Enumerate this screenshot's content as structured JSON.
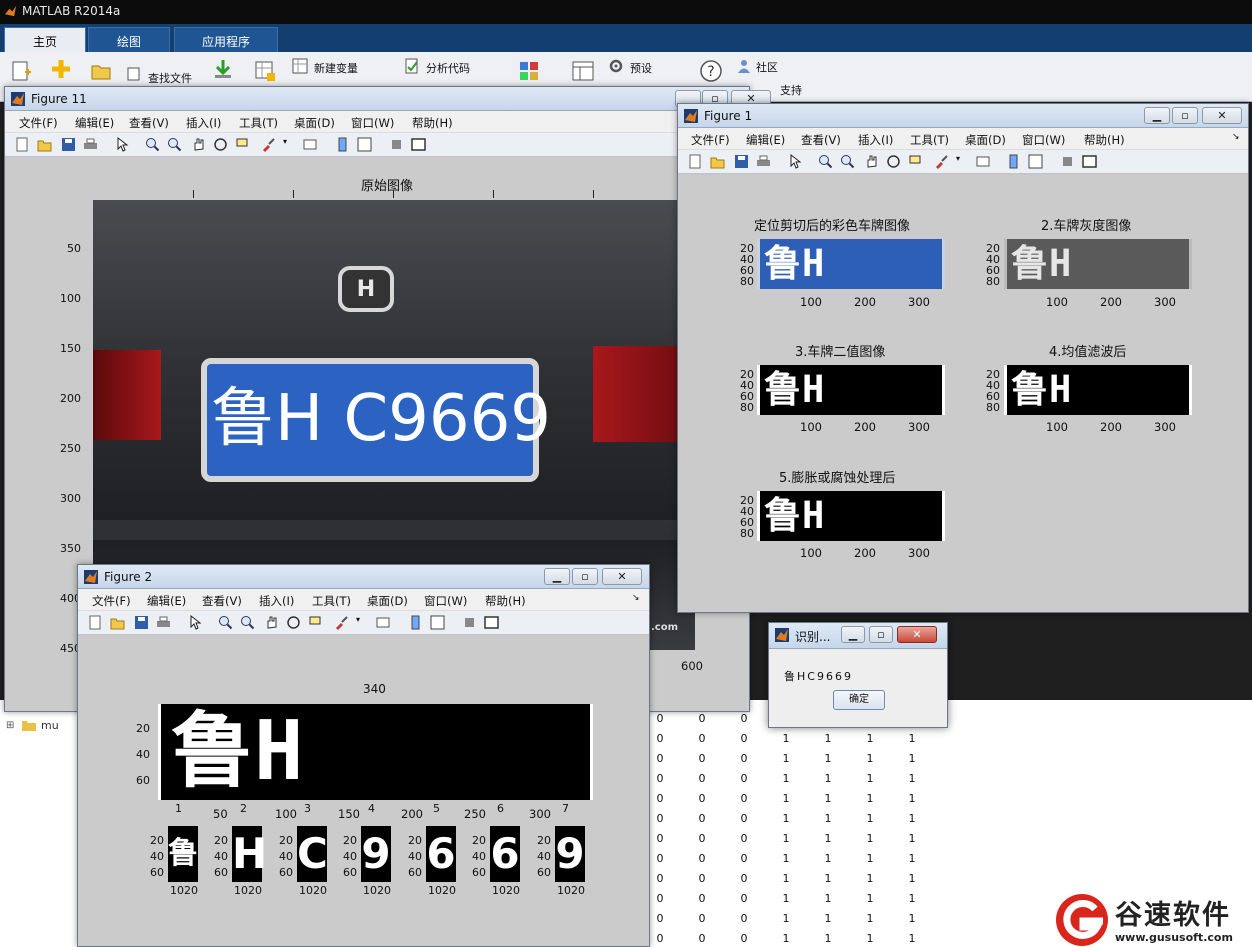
{
  "app": {
    "title": "MATLAB R2014a",
    "tabs": [
      "主页",
      "绘图",
      "应用程序"
    ],
    "ribbon": {
      "find_files": "查找文件",
      "new_variable": "新建变量",
      "analyze_code": "分析代码",
      "preferences": "预设",
      "community": "社区",
      "support": "支持"
    },
    "folder_item": "mu",
    "workspace_rows": [
      [
        "0",
        "0",
        "0",
        "1",
        "1",
        "1",
        "1"
      ],
      [
        "0",
        "0",
        "0",
        "1",
        "1",
        "1",
        "1"
      ],
      [
        "0",
        "0",
        "0",
        "1",
        "1",
        "1",
        "1"
      ],
      [
        "0",
        "0",
        "0",
        "1",
        "1",
        "1",
        "1"
      ],
      [
        "0",
        "0",
        "0",
        "1",
        "1",
        "1",
        "1"
      ],
      [
        "0",
        "0",
        "0",
        "1",
        "1",
        "1",
        "1"
      ],
      [
        "0",
        "0",
        "0",
        "1",
        "1",
        "1",
        "1"
      ],
      [
        "0",
        "0",
        "0",
        "1",
        "1",
        "1",
        "1"
      ],
      [
        "0",
        "0",
        "0",
        "1",
        "1",
        "1",
        "1"
      ],
      [
        "0",
        "0",
        "0",
        "1",
        "1",
        "1",
        "1"
      ],
      [
        "0",
        "0",
        "0",
        "1",
        "1",
        "1",
        "1"
      ],
      [
        "0",
        "0",
        "0",
        "1",
        "1",
        "1",
        "1"
      ]
    ]
  },
  "menu": [
    "文件(F)",
    "编辑(E)",
    "查看(V)",
    "插入(I)",
    "工具(T)",
    "桌面(D)",
    "窗口(W)",
    "帮助(H)"
  ],
  "fig11": {
    "title": "Figure 11",
    "plot_title": "原始图像",
    "yticks": [
      "50",
      "100",
      "150",
      "200",
      "250",
      "300",
      "350",
      "400",
      "450"
    ],
    "xtick_600": "600",
    "plate_text": "鲁H C9669",
    "watermark": ".com"
  },
  "fig1": {
    "title": "Figure 1",
    "subplots": [
      {
        "title": "定位剪切后的彩色车牌图像"
      },
      {
        "title": "2.车牌灰度图像"
      },
      {
        "title": "3.车牌二值图像"
      },
      {
        "title": "4.均值滤波后"
      },
      {
        "title": "5.膨胀或腐蚀处理后"
      }
    ],
    "plate_text": "鲁H C9669",
    "yticks": [
      "20",
      "40",
      "60",
      "80"
    ],
    "xticks": [
      "100",
      "200",
      "300"
    ]
  },
  "fig2": {
    "title": "Figure 2",
    "top_label": "340",
    "plate_text": "鲁H C9669",
    "yticks": [
      "20",
      "40",
      "60"
    ],
    "xticks": [
      "50",
      "100",
      "150",
      "200",
      "250",
      "300"
    ],
    "segment_indices": [
      "1",
      "2",
      "3",
      "4",
      "5",
      "6",
      "7"
    ],
    "chars": [
      "鲁",
      "H",
      "C",
      "9",
      "6",
      "6",
      "9"
    ],
    "small_xtick": "1020"
  },
  "dialog": {
    "title": "识别...",
    "result": "鲁HC9669",
    "ok": "确定"
  },
  "watermark": {
    "brand": "谷速软件",
    "url": "www.gususoft.com"
  }
}
